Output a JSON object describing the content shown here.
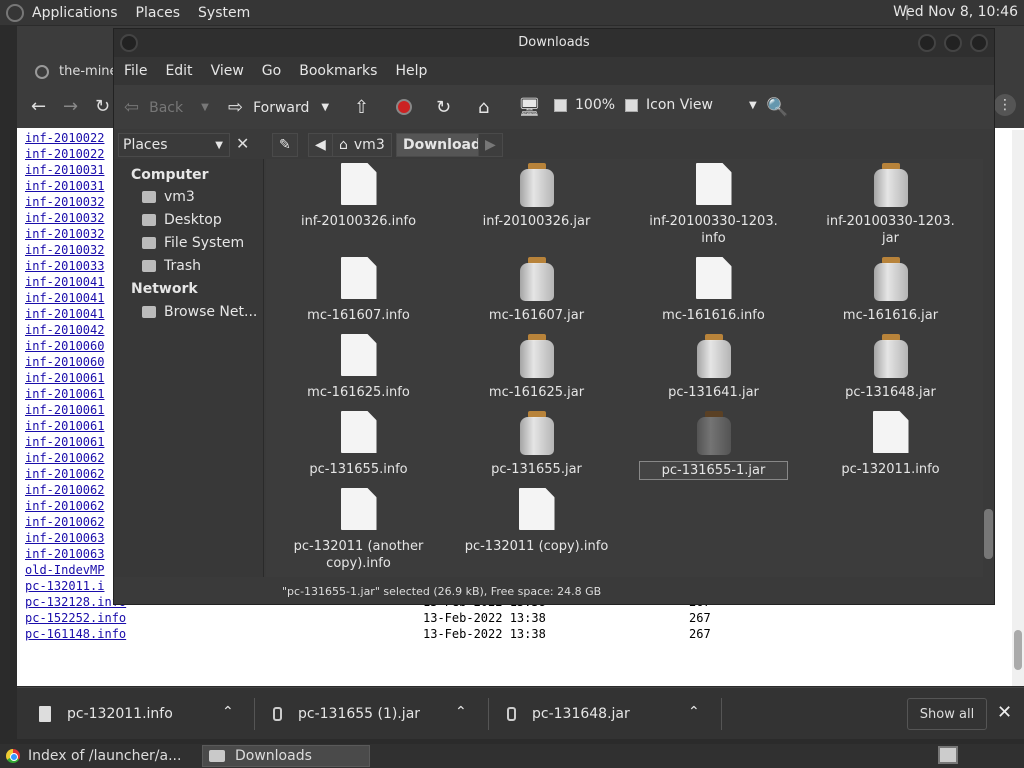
{
  "top_panel": {
    "menus": [
      "Applications",
      "Places",
      "System"
    ],
    "clock": "Wed Nov 8, 10:46"
  },
  "browser": {
    "tab_title": "the-mine",
    "listing_names": [
      "inf-2010022",
      "inf-2010022",
      "inf-2010031",
      "inf-2010031",
      "inf-2010032",
      "inf-2010032",
      "inf-2010032",
      "inf-2010032",
      "inf-2010033",
      "inf-2010041",
      "inf-2010041",
      "inf-2010041",
      "inf-2010042",
      "inf-2010060",
      "inf-2010060",
      "inf-2010061",
      "inf-2010061",
      "inf-2010061",
      "inf-2010061",
      "inf-2010061",
      "inf-2010062",
      "inf-2010062",
      "inf-2010062",
      "inf-2010062",
      "inf-2010062",
      "inf-2010063",
      "inf-2010063",
      "old-IndevMP",
      "pc-132011.i"
    ],
    "full_rows": [
      {
        "name": "pc-132128.info",
        "date": "13-Feb-2022 13:38",
        "size": "267"
      },
      {
        "name": "pc-152252.info",
        "date": "13-Feb-2022 13:38",
        "size": "267"
      },
      {
        "name": "pc-161148.info",
        "date": "13-Feb-2022 13:38",
        "size": "267"
      }
    ]
  },
  "shelf": {
    "items": [
      {
        "name": "pc-132011.info",
        "kind": "file"
      },
      {
        "name": "pc-131655 (1).jar",
        "kind": "jar"
      },
      {
        "name": "pc-131648.jar",
        "kind": "jar"
      }
    ],
    "show_all": "Show all",
    "close": "✕"
  },
  "taskbar": {
    "items": [
      "Index of /launcher/a...",
      "Downloads"
    ]
  },
  "fm": {
    "title": "Downloads",
    "menu": [
      "File",
      "Edit",
      "View",
      "Go",
      "Bookmarks",
      "Help"
    ],
    "toolbar": {
      "back": "Back",
      "forward": "Forward",
      "zoom": "100%",
      "view_mode": "Icon View"
    },
    "places_label": "Places",
    "breadcrumb": [
      "vm3",
      "Downloads"
    ],
    "sidebar": {
      "computer_header": "Computer",
      "computer_items": [
        "vm3",
        "Desktop",
        "File System",
        "Trash"
      ],
      "network_header": "Network",
      "network_items": [
        "Browse Net..."
      ]
    },
    "files": [
      {
        "name": "inf-20100326.info",
        "type": "doc"
      },
      {
        "name": "inf-20100326.jar",
        "type": "jar"
      },
      {
        "name": "inf-20100330-1203.\ninfo",
        "type": "doc"
      },
      {
        "name": "inf-20100330-1203.\njar",
        "type": "jar"
      },
      {
        "name": "mc-161607.info",
        "type": "doc"
      },
      {
        "name": "mc-161607.jar",
        "type": "jar"
      },
      {
        "name": "mc-161616.info",
        "type": "doc"
      },
      {
        "name": "mc-161616.jar",
        "type": "jar"
      },
      {
        "name": "mc-161625.info",
        "type": "doc"
      },
      {
        "name": "mc-161625.jar",
        "type": "jar"
      },
      {
        "name": "pc-131641.jar",
        "type": "jar"
      },
      {
        "name": "pc-131648.jar",
        "type": "jar"
      },
      {
        "name": "pc-131655.info",
        "type": "doc"
      },
      {
        "name": "pc-131655.jar",
        "type": "jar"
      },
      {
        "name": "pc-131655-1.jar",
        "type": "jar",
        "selected": true
      },
      {
        "name": "pc-132011.info",
        "type": "doc"
      },
      {
        "name": "pc-132011 (another\ncopy).info",
        "type": "doc"
      },
      {
        "name": "pc-132011 (copy).info",
        "type": "doc"
      }
    ],
    "status": "\"pc-131655-1.jar\" selected (26.9 kB), Free space: 24.8 GB"
  }
}
